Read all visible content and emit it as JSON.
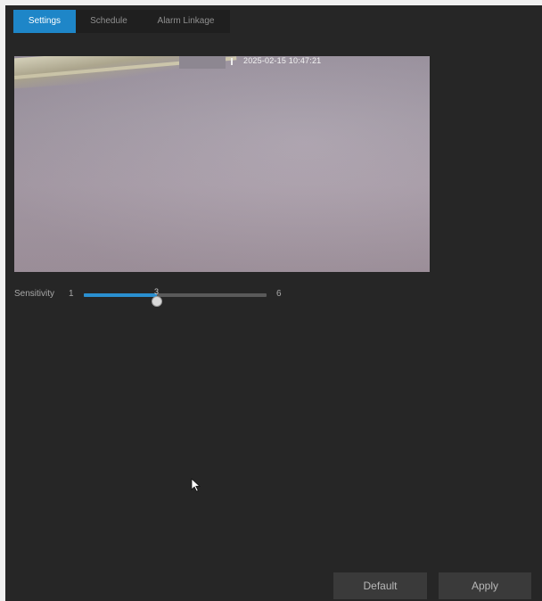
{
  "tabs": [
    {
      "label": "Settings",
      "active": true
    },
    {
      "label": "Schedule",
      "active": false
    },
    {
      "label": "Alarm Linkage",
      "active": false
    }
  ],
  "preview": {
    "timestamp": "2025-02-15 10:47:21"
  },
  "sensitivity": {
    "label": "Sensitivity",
    "min": 1,
    "max": 6,
    "value": 3,
    "min_label": "1",
    "max_label": "6",
    "value_label": "3"
  },
  "buttons": {
    "default_label": "Default",
    "apply_label": "Apply"
  },
  "colors": {
    "accent": "#1e86c8",
    "panel_bg": "#262626"
  }
}
